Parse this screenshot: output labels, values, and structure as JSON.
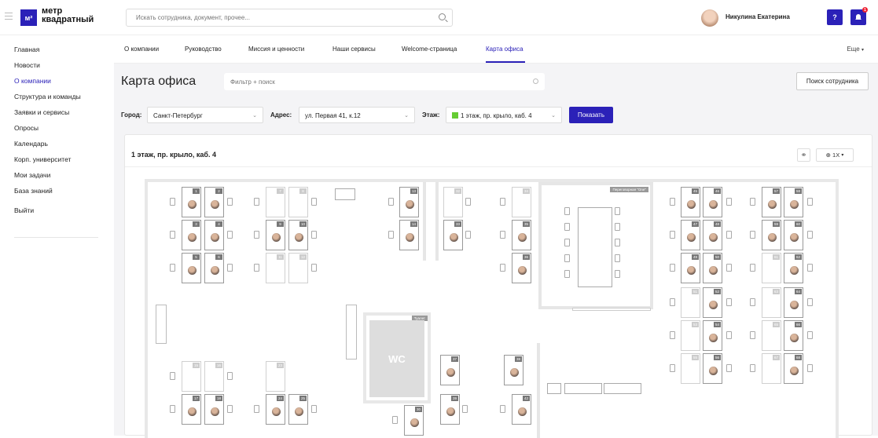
{
  "app": {
    "logo_mark": "м²",
    "logo_line1": "метр",
    "logo_line2": "квадратный"
  },
  "header": {
    "search_placeholder": "Искать сотрудника, документ, прочее...",
    "user_name": "Никулина Екатерина",
    "help_label": "?",
    "notif_count": "1",
    "icons": [
      "menu-icon",
      "search-icon",
      "help-icon",
      "bell-icon"
    ]
  },
  "sidebar": {
    "items": [
      {
        "label": "Главная",
        "active": false
      },
      {
        "label": "Новости",
        "active": false
      },
      {
        "label": "О компании",
        "active": true
      },
      {
        "label": "Структура и команды",
        "active": false
      },
      {
        "label": "Заявки и сервисы",
        "active": false
      },
      {
        "label": "Опросы",
        "active": false
      },
      {
        "label": "Календарь",
        "active": false
      },
      {
        "label": "Корп. университет",
        "active": false
      },
      {
        "label": "Мои задачи",
        "active": false
      },
      {
        "label": "База знаний",
        "active": false
      }
    ],
    "logout": "Выйти"
  },
  "tabs": {
    "items": [
      "О компании",
      "Руководство",
      "Миссия и ценности",
      "Наши сервисы",
      "Welcome-страница",
      "Карта офиса"
    ],
    "active": "Карта офиса",
    "more": "Еще"
  },
  "page": {
    "title": "Карта офиса",
    "filter_placeholder": "Фильтр + поиск",
    "find_employee": "Поиск сотрудника"
  },
  "filters": {
    "city_label": "Город:",
    "city_value": "Санкт-Петербург",
    "address_label": "Адрес:",
    "address_value": "ул. Первая 41, к.12",
    "floor_label": "Этаж:",
    "floor_value": "1 этаж, пр. крыло, каб. 4",
    "show_button": "Показать",
    "floor_color": "#66cc33"
  },
  "map": {
    "title": "1 этаж, пр. крыло, каб. 4",
    "zoom": "1X",
    "meeting_room": "Переговорная \"One\"",
    "toilet": "Туалет",
    "wc": "WC",
    "desks": [
      {
        "n": "1",
        "occ": true
      },
      {
        "n": "2",
        "occ": true
      },
      {
        "n": "3",
        "occ": true
      },
      {
        "n": "4",
        "occ": true
      },
      {
        "n": "5",
        "occ": true
      },
      {
        "n": "6",
        "occ": true
      },
      {
        "n": "7",
        "occ": false
      },
      {
        "n": "8",
        "occ": false
      },
      {
        "n": "9",
        "occ": true
      },
      {
        "n": "10",
        "occ": true
      },
      {
        "n": "11",
        "occ": false
      },
      {
        "n": "12",
        "occ": false
      },
      {
        "n": "13",
        "occ": true
      },
      {
        "n": "14",
        "occ": true
      },
      {
        "n": "32",
        "occ": false
      },
      {
        "n": "33",
        "occ": true
      },
      {
        "n": "34",
        "occ": false
      },
      {
        "n": "35",
        "occ": true
      },
      {
        "n": "36",
        "occ": true
      },
      {
        "n": "45",
        "occ": true
      },
      {
        "n": "46",
        "occ": true
      },
      {
        "n": "47",
        "occ": true
      },
      {
        "n": "48",
        "occ": true
      },
      {
        "n": "49",
        "occ": true
      },
      {
        "n": "50",
        "occ": true
      },
      {
        "n": "51",
        "occ": false
      },
      {
        "n": "52",
        "occ": true
      },
      {
        "n": "53",
        "occ": false
      },
      {
        "n": "54",
        "occ": true
      },
      {
        "n": "55",
        "occ": false
      },
      {
        "n": "56",
        "occ": true
      },
      {
        "n": "57",
        "occ": true
      },
      {
        "n": "58",
        "occ": true
      },
      {
        "n": "59",
        "occ": true
      },
      {
        "n": "60",
        "occ": true
      },
      {
        "n": "61",
        "occ": false
      },
      {
        "n": "62",
        "occ": true
      },
      {
        "n": "63",
        "occ": false
      },
      {
        "n": "64",
        "occ": true
      },
      {
        "n": "65",
        "occ": false
      },
      {
        "n": "66",
        "occ": true
      },
      {
        "n": "67",
        "occ": false
      },
      {
        "n": "68",
        "occ": true
      },
      {
        "n": "15",
        "occ": false
      },
      {
        "n": "16",
        "occ": false
      },
      {
        "n": "17",
        "occ": true
      },
      {
        "n": "18",
        "occ": true
      },
      {
        "n": "23",
        "occ": false
      },
      {
        "n": "24",
        "occ": true
      },
      {
        "n": "25",
        "occ": true
      },
      {
        "n": "30",
        "occ": true
      },
      {
        "n": "37",
        "occ": true
      },
      {
        "n": "38",
        "occ": true
      },
      {
        "n": "39",
        "occ": true
      },
      {
        "n": "42",
        "occ": true
      }
    ]
  }
}
